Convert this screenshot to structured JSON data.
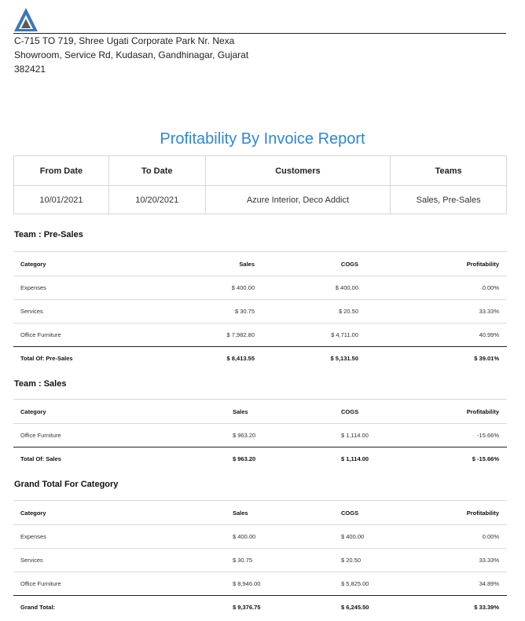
{
  "company": {
    "logo_icon": "company-logo-icon",
    "address_lines": [
      "C-715 TO 719, Shree Ugati Corporate Park Nr. Nexa",
      "Showroom, Service Rd, Kudasan, Gandhinagar, Gujarat",
      "382421"
    ]
  },
  "report": {
    "title": "Profitability By Invoice Report",
    "title_color": "#2f86d6"
  },
  "filters": {
    "headers": [
      "From Date",
      "To Date",
      "Customers",
      "Teams"
    ],
    "values": [
      "10/01/2021",
      "10/20/2021",
      "Azure Interior, Deco Addict",
      "Sales, Pre-Sales"
    ]
  },
  "columns": [
    "Category",
    "Sales",
    "COGS",
    "Profitability"
  ],
  "sections": [
    {
      "title": "Team : Pre-Sales",
      "rows": [
        [
          "Expenses",
          "$ 400.00",
          "$ 400.00",
          "0.00%"
        ],
        [
          "Services",
          "$ 30.75",
          "$ 20.50",
          "33.33%"
        ],
        [
          "Office Furniture",
          "$ 7,982.80",
          "$ 4,711.00",
          "40.99%"
        ]
      ],
      "total": [
        "Total Of: Pre-Sales",
        "$ 8,413.55",
        "$ 5,131.50",
        "$ 39.01%"
      ]
    },
    {
      "title": "Team : Sales",
      "rows": [
        [
          "Office Furniture",
          "$ 963.20",
          "$ 1,114.00",
          "-15.66%"
        ]
      ],
      "total": [
        "Total Of: Sales",
        "$ 963.20",
        "$ 1,114.00",
        "$ -15.66%"
      ]
    },
    {
      "title": "Grand Total For Category",
      "rows": [
        [
          "Expenses",
          "$ 400.00",
          "$ 400.00",
          "0.00%"
        ],
        [
          "Services",
          "$ 30.75",
          "$ 20.50",
          "33.33%"
        ],
        [
          "Office Furniture",
          "$ 8,946.00",
          "$ 5,825.00",
          "34.89%"
        ]
      ],
      "total": [
        "Grand Total:",
        "$ 9,376.75",
        "$ 6,245.50",
        "$ 33.39%"
      ]
    }
  ]
}
